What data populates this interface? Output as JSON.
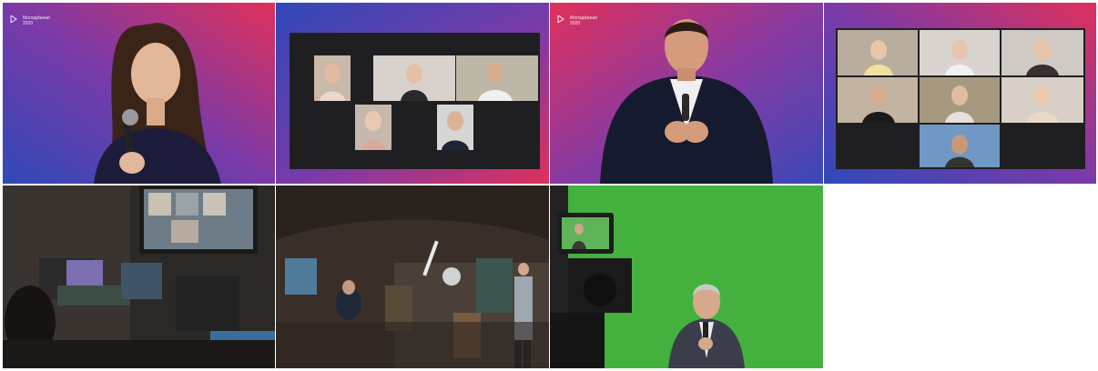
{
  "gallery": {
    "tiles": [
      {
        "id": "presenter-woman",
        "logo": {
          "line1": "Молодёжная",
          "line2": "2020"
        }
      },
      {
        "id": "video-call-grid-5"
      },
      {
        "id": "presenter-man",
        "logo": {
          "line1": "Молодёжная",
          "line2": "2020"
        }
      },
      {
        "id": "video-call-grid-7"
      },
      {
        "id": "control-room"
      },
      {
        "id": "studio-set"
      },
      {
        "id": "green-screen"
      }
    ]
  },
  "colors": {
    "gradient_blue": "#2f49b8",
    "gradient_purple": "#7a3aa8",
    "gradient_red": "#e0305a",
    "call_panel": "#1f1f22",
    "green_screen": "#3fae3a",
    "studio_dark": "#2a2622"
  }
}
